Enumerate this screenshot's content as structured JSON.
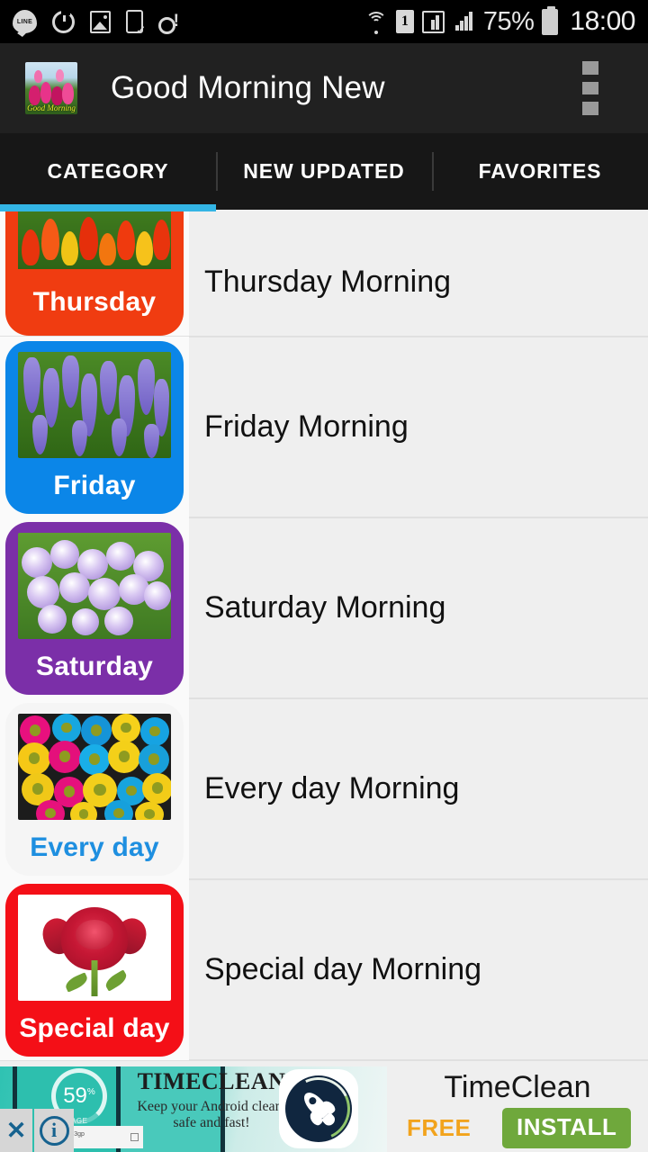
{
  "status_bar": {
    "time": "18:00",
    "battery_percent": "75%",
    "sim_label": "1",
    "line_label": "LINE",
    "icons": [
      "line-icon",
      "power-sync-icon",
      "gallery-icon",
      "phone-download-icon",
      "alert-icon",
      "wifi-icon",
      "sim-1-icon",
      "signal-1-icon",
      "signal-2-icon",
      "battery-icon"
    ]
  },
  "app_bar": {
    "title": "Good Morning New",
    "app_icon_caption": "Good Morning",
    "overflow_label": "More options"
  },
  "tabs": [
    {
      "label": "CATEGORY",
      "active": true
    },
    {
      "label": "NEW UPDATED",
      "active": false
    },
    {
      "label": "FAVORITES",
      "active": false
    }
  ],
  "colors": {
    "tab_indicator": "#33b5e5",
    "app_bar_bg": "#212121",
    "tab_bar_bg": "#171717",
    "list_bg": "#efefef",
    "install_button": "#6fa83c",
    "free_text": "#f2a31c"
  },
  "list": [
    {
      "title": "Thursday Morning",
      "card_label": "Thursday",
      "card_color": "#f03c11",
      "label_color": "#ffffff",
      "flower": "red-tulips"
    },
    {
      "title": "Friday Morning",
      "card_label": "Friday",
      "card_color": "#0b86e8",
      "label_color": "#ffffff",
      "flower": "purple-grape-hyacinth"
    },
    {
      "title": "Saturday Morning",
      "card_label": "Saturday",
      "card_color": "#7b2fa8",
      "label_color": "#ffffff",
      "flower": "purple-crocus"
    },
    {
      "title": "Every day Morning",
      "card_label": "Every day",
      "card_color": "#f5f5f5",
      "label_color": "#1e8fe0",
      "flower": "mixed-daisies"
    },
    {
      "title": "Special day Morning",
      "card_label": "Special day",
      "card_color": "#f40f17",
      "label_color": "#ffffff",
      "flower": "red-rose"
    }
  ],
  "ad": {
    "brand_small": "TIMECLEAN",
    "tagline_line1": "Keep your Android clean,",
    "tagline_line2": "safe and fast!",
    "title": "TimeClean",
    "price": "FREE",
    "cta": "INSTALL",
    "phone_percent": "59",
    "phone_percent_unit": "%",
    "phone_storage_label": "STORAGE",
    "phone_file_label": "_004235.3gp",
    "close_label": "✕",
    "info_label": "i"
  }
}
